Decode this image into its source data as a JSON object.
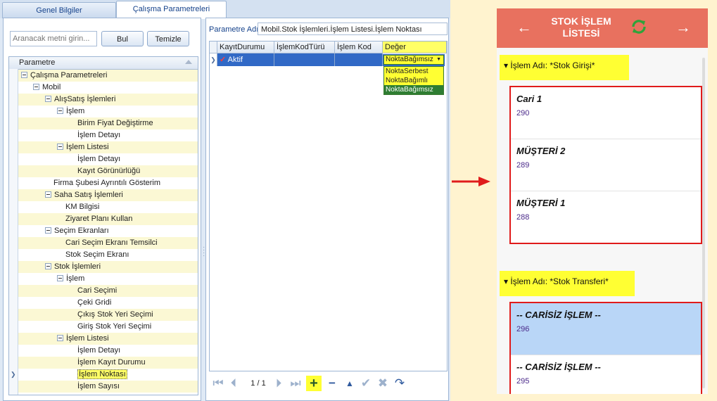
{
  "tabs": [
    {
      "label": "Genel Bilgiler",
      "active": false
    },
    {
      "label": "Çalışma Parametreleri",
      "active": true
    }
  ],
  "search": {
    "placeholder": "Aranacak metni girin...",
    "find_label": "Bul",
    "clear_label": "Temizle"
  },
  "tree": {
    "header": "Parametre",
    "rows": [
      {
        "label": "Çalışma Parametreleri",
        "level": 0,
        "expander": true,
        "hl": true
      },
      {
        "label": "Mobil",
        "level": 1,
        "expander": true,
        "hl": false
      },
      {
        "label": "AlışSatış İşlemleri",
        "level": 2,
        "expander": true,
        "hl": true
      },
      {
        "label": "İşlem",
        "level": 3,
        "expander": true,
        "hl": false
      },
      {
        "label": "Birim Fiyat Değiştirme",
        "level": 4,
        "expander": false,
        "hl": true
      },
      {
        "label": "İşlem Detayı",
        "level": 4,
        "expander": false,
        "hl": false
      },
      {
        "label": "İşlem Listesi",
        "level": 3,
        "expander": true,
        "hl": true
      },
      {
        "label": "İşlem Detayı",
        "level": 4,
        "expander": false,
        "hl": false
      },
      {
        "label": "Kayıt Görünürlüğü",
        "level": 4,
        "expander": false,
        "hl": true
      },
      {
        "label": "Firma Şubesi Ayrıntılı Gösterim",
        "level": 2,
        "expander": false,
        "hl": false
      },
      {
        "label": "Saha Satış İşlemleri",
        "level": 2,
        "expander": true,
        "hl": true
      },
      {
        "label": "KM Bilgisi",
        "level": 3,
        "expander": false,
        "hl": false
      },
      {
        "label": "Ziyaret Planı Kullan",
        "level": 3,
        "expander": false,
        "hl": true
      },
      {
        "label": "Seçim Ekranları",
        "level": 2,
        "expander": true,
        "hl": false
      },
      {
        "label": "Cari Seçim Ekranı Temsilci",
        "level": 3,
        "expander": false,
        "hl": true
      },
      {
        "label": "Stok Seçim Ekranı",
        "level": 3,
        "expander": false,
        "hl": false
      },
      {
        "label": "Stok İşlemleri",
        "level": 2,
        "expander": true,
        "hl": true
      },
      {
        "label": "İşlem",
        "level": 3,
        "expander": true,
        "hl": false
      },
      {
        "label": "Cari Seçimi",
        "level": 4,
        "expander": false,
        "hl": true
      },
      {
        "label": "Çeki Gridi",
        "level": 4,
        "expander": false,
        "hl": false
      },
      {
        "label": "Çıkış Stok Yeri Seçimi",
        "level": 4,
        "expander": false,
        "hl": true
      },
      {
        "label": "Giriş Stok Yeri Seçimi",
        "level": 4,
        "expander": false,
        "hl": false
      },
      {
        "label": "İşlem Listesi",
        "level": 3,
        "expander": true,
        "hl": true
      },
      {
        "label": "İşlem Detayı",
        "level": 4,
        "expander": false,
        "hl": false
      },
      {
        "label": "İşlem Kayıt Durumu",
        "level": 4,
        "expander": false,
        "hl": true
      },
      {
        "label": "İşlem Noktası",
        "level": 4,
        "expander": false,
        "hl": false,
        "selected": true
      },
      {
        "label": "İşlem Sayısı",
        "level": 4,
        "expander": false,
        "hl": true
      }
    ]
  },
  "param": {
    "label": "Parametre Adı",
    "value": "Mobil.Stok İşlemleri.İşlem Listesi.İşlem Noktası"
  },
  "grid": {
    "columns": [
      "KayıtDurumu",
      "İşlemKodTürü",
      "İşlem Kod",
      "Değer"
    ],
    "row": {
      "status": "Aktif",
      "value": "NoktaBağımsız"
    },
    "options": [
      "NoktaSerbest",
      "NoktaBağımlı",
      "NoktaBağımsız"
    ],
    "selected_option": 2
  },
  "pager": {
    "page": "1 / 1"
  },
  "mobile": {
    "title": "STOK İŞLEM LİSTESİ",
    "groups": [
      {
        "label": "İşlem Adı: *Stok Girişi*",
        "items": [
          {
            "name": "Cari 1",
            "code": "290"
          },
          {
            "name": "MÜŞTERİ 2",
            "code": "289"
          },
          {
            "name": "MÜŞTERİ 1",
            "code": "288"
          }
        ]
      },
      {
        "label": "İşlem Adı: *Stok Transferi*",
        "items": [
          {
            "name": "-- CARİSİZ İŞLEM --",
            "code": "296",
            "selected": true
          },
          {
            "name": "-- CARİSİZ İŞLEM --",
            "code": "295"
          }
        ]
      }
    ]
  },
  "colors": {
    "accent_header": "#e8715f",
    "highlight_yellow": "#ffff33",
    "selection_blue": "#3169c6",
    "border_red": "#e01b1b"
  }
}
